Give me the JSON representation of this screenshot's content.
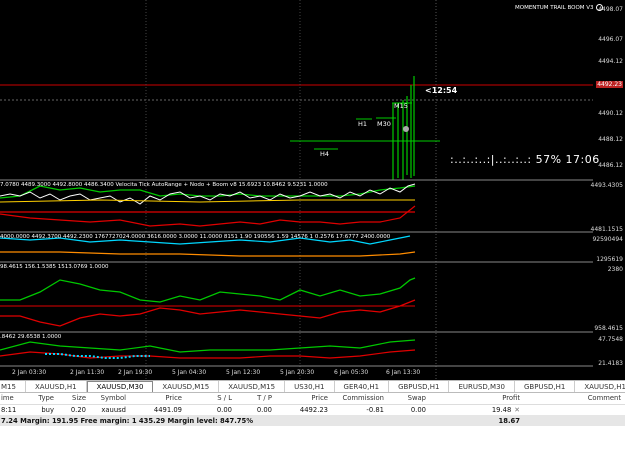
{
  "indicator_name": "MOMENTUM TRAIL BOOM V3",
  "countdown": "<12:54",
  "progress_text": ":..:..:..:|..:..:..:  57% 17:06",
  "progress_percent": 57,
  "levels": {
    "m15": "M15",
    "h1": "H1",
    "m30": "M30",
    "h4": "H4"
  },
  "price_axis": [
    "4498.07",
    "4496.07",
    "4494.12",
    "4490.12",
    "4488.12",
    "4486.12",
    "4493.4305",
    "4481.1515",
    "92590494",
    "1295619",
    "2380",
    "958.4615",
    "47.7548",
    "21.4183"
  ],
  "current_price": "4492.23",
  "subwindows": [
    {
      "title": "7.0780 4489.3000 4492.8000 4486.3400  Velocita Tick AutoRange + Nodo + Boom v8 15.6923 10.8462 9.5231 1.0000"
    },
    {
      "title": "4000.0000 4492.3700 4492.2300 1767727024.0000 3616.0000 3.0000 11.0000 8151 1.90 190556 1.59 14576 1 0.2576 17:6777 2400.0000"
    },
    {
      "title": "98.4615 156.1.5385 1513.0769 1.0000"
    },
    {
      "title": ".8462 29.6538 1.0000"
    }
  ],
  "time_axis": [
    "2 Jan 03:30",
    "2 Jan 11:30",
    "2 Jan 19:30",
    "5 Jan 04:30",
    "5 Jan 12:30",
    "5 Jan 20:30",
    "6 Jan 05:30",
    "6 Jan 13:30"
  ],
  "tabs": [
    "M15",
    "XAUUSD,H1",
    "XAUUSD,M30",
    "XAUUSD,M15",
    "XAUUSD,M15",
    "US30,H1",
    "GER40,H1",
    "GBPUSD,H1",
    "EURUSD,M30",
    "GBPUSD,H1",
    "XAUUSD,H1"
  ],
  "active_tab": 2,
  "terminal": {
    "headers": [
      "ime",
      "Type",
      "Size",
      "Symbol",
      "Price",
      "S / L",
      "T / P",
      "Price",
      "Commission",
      "Swap",
      "Profit",
      "Comment"
    ],
    "row": [
      "8:11",
      "buy",
      "0.20",
      "xauusd",
      "4491.09",
      "0.00",
      "0.00",
      "4492.23",
      "-0.81",
      "0.00",
      "19.48",
      ""
    ],
    "summary": "7.24  Margin: 191.95  Free margin: 1 435.29  Margin level: 847.75%",
    "summary_profit": "18.67"
  },
  "colors": {
    "green": "#00c800",
    "red": "#e00000",
    "orange": "#ff8c00",
    "cyan": "#00d8ff",
    "axis_red": "#b22222"
  }
}
